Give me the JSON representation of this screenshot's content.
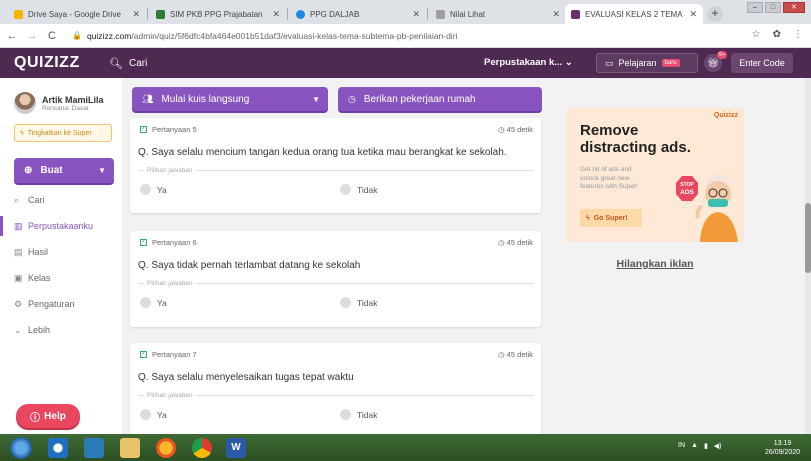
{
  "browser": {
    "tabs": [
      {
        "title": "Drive Saya - Google Drive",
        "color": "#f4b400",
        "active": false
      },
      {
        "title": "SIM PKB PPG Prajabatan",
        "color": "#2e7d32",
        "active": false
      },
      {
        "title": "PPG DALJAB",
        "color": "#1e88e5",
        "active": false
      },
      {
        "title": "Nilai Lihat",
        "color": "#9e9e9e",
        "active": false
      },
      {
        "title": "EVALUASI KELAS 2 TEMA 3 SU",
        "color": "#6d2c6f",
        "active": true
      }
    ],
    "new_tab": "+",
    "url_domain": "quizizz.com",
    "url_path": "/admin/quiz/5f6dfc4bfa464e001b51daf3/evaluasi-kelas-tema-subtema-pb-penilaian-diri"
  },
  "header": {
    "logo": "QUIZIZZ",
    "search_placeholder": "Cari",
    "library_label": "Perpustakaan k...",
    "lesson_label": "Pelajaran",
    "lesson_badge": "baru",
    "gift_badge": "9+",
    "enter_code": "Enter Code"
  },
  "sidebar": {
    "user_name": "Artik MamiLila",
    "user_sub": "Rencana: Dasar",
    "upgrade": "Tingkatkan ke Super",
    "create": "Buat",
    "items": [
      {
        "label": "Cari",
        "icon": "search-icon"
      },
      {
        "label": "Perpustakaanku",
        "icon": "library-icon",
        "active": true
      },
      {
        "label": "Hasil",
        "icon": "chart-icon"
      },
      {
        "label": "Kelas",
        "icon": "class-icon"
      },
      {
        "label": "Pengaturan",
        "icon": "gear-icon"
      },
      {
        "label": "Lebih",
        "icon": "chevron-down-icon"
      }
    ],
    "help": "Help"
  },
  "actions": {
    "live": "Mulai kuis langsung",
    "homework": "Berikan pekerjaan rumah"
  },
  "questions": [
    {
      "label": "Pertanyaan 5",
      "time": "45 detik",
      "text": "Q. Saya selalu mencium tangan kedua orang tua ketika mau berangkat ke sekolah.",
      "choices_label": "Pilihan jawaban",
      "options": [
        "Ya",
        "Tidak"
      ]
    },
    {
      "label": "Pertanyaan 6",
      "time": "45 detik",
      "text": "Q. Saya tidak pernah terlambat datang ke sekolah",
      "choices_label": "Pilihan jawaban",
      "options": [
        "Ya",
        "Tidak"
      ]
    },
    {
      "label": "Pertanyaan 7",
      "time": "45 detik",
      "text": "Q. Saya selalu menyelesaikan tugas tepat waktu",
      "choices_label": "Pilihan jawaban",
      "options": [
        "Ya",
        "Tidak"
      ]
    }
  ],
  "ad": {
    "brand": "Quizizz",
    "title_line1": "Remove",
    "title_line2": "distracting ads.",
    "text": "Get rid of ads and unlock great new features with Super!",
    "button": "Go Super!",
    "stop_line1": "STOP",
    "stop_line2": "ADS",
    "remove": "Hilangkan iklan"
  },
  "taskbar": {
    "lang": "IN",
    "time": "13:19",
    "date": "26/09/2020"
  }
}
